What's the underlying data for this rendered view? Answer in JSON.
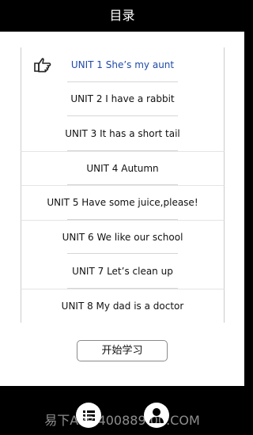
{
  "header": {
    "title": "目录"
  },
  "units": [
    {
      "label": "UNIT 1  She’s my aunt"
    },
    {
      "label": "UNIT 2  I have a rabbit"
    },
    {
      "label": "UNIT 3  It has a short tail"
    },
    {
      "label": "UNIT 4  Autumn"
    },
    {
      "label": "UNIT 5  Have some juice,please!"
    },
    {
      "label": "UNIT 6  We like our school"
    },
    {
      "label": "UNIT 7  Let’s clean up"
    },
    {
      "label": "UNIT 8  My dad is a doctor"
    }
  ],
  "start_button": {
    "label": "开始学习"
  },
  "watermark": "易下APP  400889  00.COM",
  "icons": {
    "pointer": "pointing-hand-icon",
    "list": "list-icon",
    "user": "user-icon"
  },
  "colors": {
    "active_unit": "#1f4aa8",
    "bar": "#000000"
  }
}
